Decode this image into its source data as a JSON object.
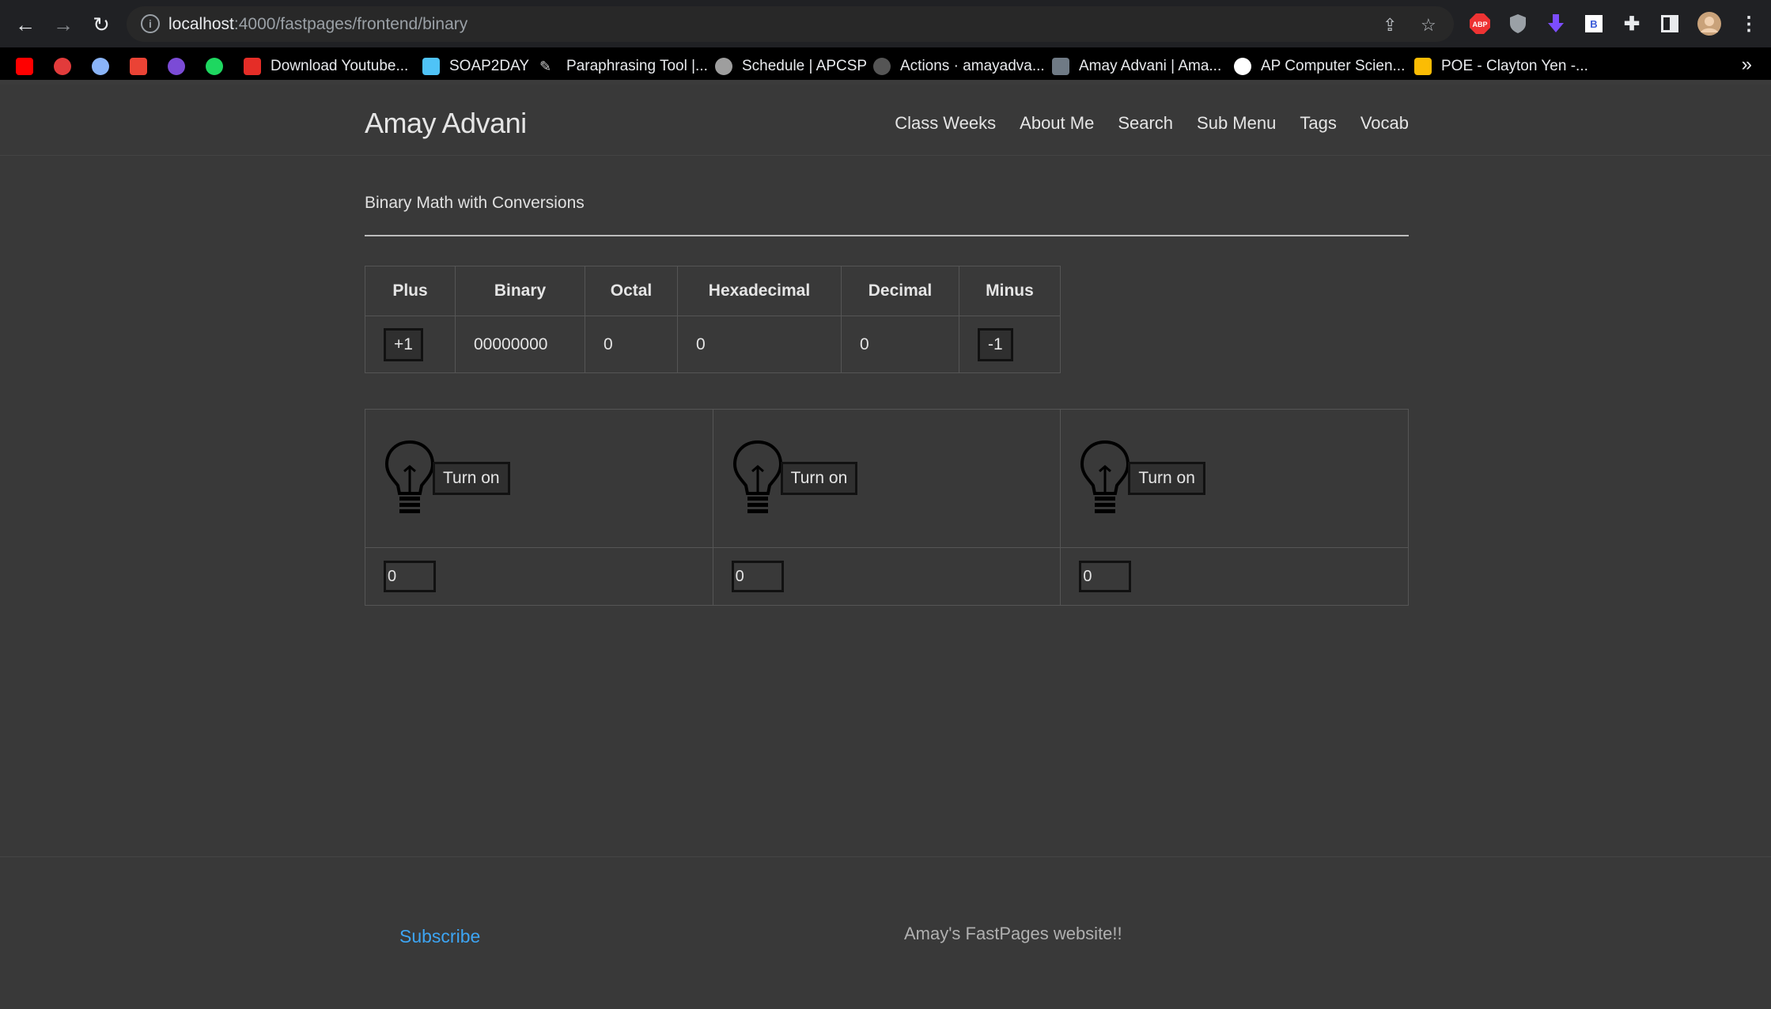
{
  "browser": {
    "url_host": "localhost",
    "url_path": ":4000/fastpages/frontend/binary",
    "bookmarks": [
      {
        "label": "",
        "color": "#ff0000"
      },
      {
        "label": "",
        "color": "#e23b3b"
      },
      {
        "label": "",
        "color": "#8ab4f8"
      },
      {
        "label": "",
        "color": "#ea4335"
      },
      {
        "label": "",
        "color": "#7b4bd6"
      },
      {
        "label": "",
        "color": "#1ed760"
      },
      {
        "label": "Download Youtube...",
        "color": "#e52d27"
      },
      {
        "label": "SOAP2DAY",
        "color": "#4fc3f7"
      },
      {
        "label": "Paraphrasing Tool |...",
        "color": "#cccccc"
      },
      {
        "label": "Schedule | APCSP",
        "color": "#9e9e9e"
      },
      {
        "label": "Actions · amayadva...",
        "color": "#555555"
      },
      {
        "label": "Amay Advani | Ama...",
        "color": "#6f7a85"
      },
      {
        "label": "AP Computer Scien...",
        "color": "#ffffff"
      },
      {
        "label": "POE - Clayton Yen -...",
        "color": "#fbbc04"
      }
    ],
    "more": "»"
  },
  "site": {
    "title": "Amay Advani",
    "nav": [
      "Class Weeks",
      "About Me",
      "Search",
      "Sub Menu",
      "Tags",
      "Vocab"
    ]
  },
  "post": {
    "title": "Binary Math with Conversions"
  },
  "calculator": {
    "headers": [
      "Plus",
      "Binary",
      "Octal",
      "Hexadecimal",
      "Decimal",
      "Minus"
    ],
    "plus_label": "+1",
    "binary": "00000000",
    "octal": "0",
    "hexadecimal": "0",
    "decimal": "0",
    "minus_label": "-1"
  },
  "bits": [
    {
      "button": "Turn on",
      "value": "0"
    },
    {
      "button": "Turn on",
      "value": "0"
    },
    {
      "button": "Turn on",
      "value": "0"
    }
  ],
  "footer": {
    "subscribe": "Subscribe",
    "description": "Amay's FastPages website!!"
  }
}
